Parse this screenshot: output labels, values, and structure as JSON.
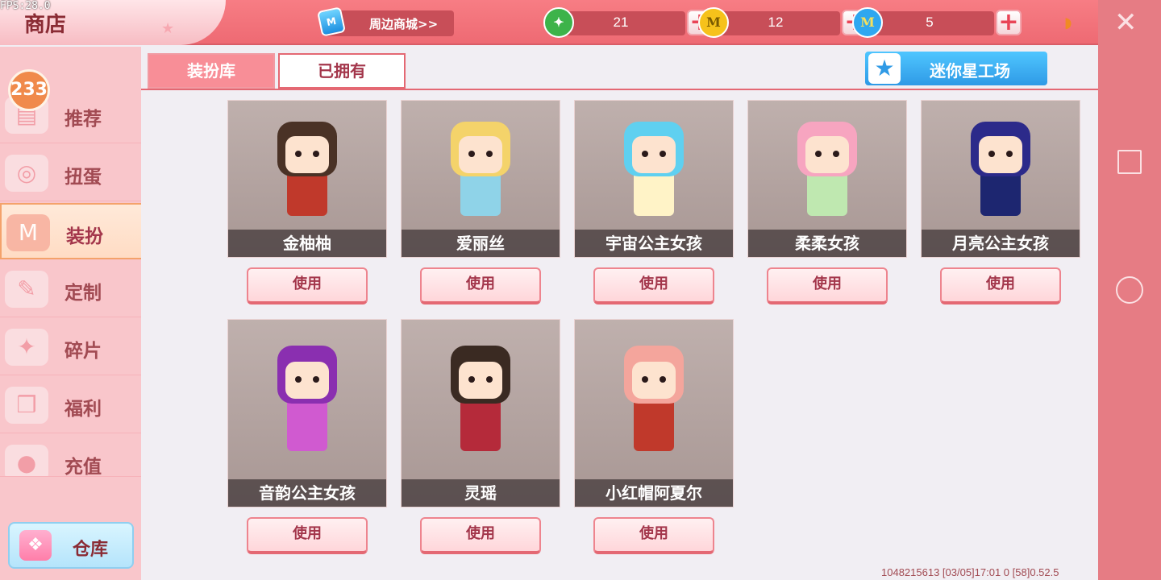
{
  "fps": "FPS:28.0",
  "header": {
    "title": "商店",
    "merch_label": "周边商城>>",
    "currencies": [
      {
        "name": "green-gem",
        "symbol": "✦",
        "amount": "21",
        "color": "#3db34a"
      },
      {
        "name": "gold-coin",
        "symbol": "M",
        "amount": "12",
        "color": "#f6c21b"
      },
      {
        "name": "blue-coin",
        "symbol": "M",
        "amount": "5",
        "color": "#2fa7f0"
      }
    ]
  },
  "sidebar": {
    "badge": "233",
    "items": [
      {
        "label": "推荐",
        "icon": "recommend-icon"
      },
      {
        "label": "扭蛋",
        "icon": "gacha-icon"
      },
      {
        "label": "装扮",
        "icon": "outfit-icon",
        "active": true
      },
      {
        "label": "定制",
        "icon": "custom-icon"
      },
      {
        "label": "碎片",
        "icon": "fragment-icon"
      },
      {
        "label": "福利",
        "icon": "gift-icon"
      },
      {
        "label": "充值",
        "icon": "recharge-icon"
      }
    ],
    "warehouse_label": "仓库"
  },
  "tabs": [
    {
      "label": "装扮库",
      "active": false
    },
    {
      "label": "已拥有",
      "active": true
    }
  ],
  "workshop_label": "迷你星工场",
  "use_label": "使用",
  "skins": [
    {
      "name": "金柚柚",
      "hair": "#4a3226",
      "outfit": "#c0392b"
    },
    {
      "name": "爱丽丝",
      "hair": "#f4d36a",
      "outfit": "#8fd3e8"
    },
    {
      "name": "宇宙公主女孩",
      "hair": "#5fd0f0",
      "outfit": "#fff3c7"
    },
    {
      "name": "柔柔女孩",
      "hair": "#f7a5c0",
      "outfit": "#bfe8b0"
    },
    {
      "name": "月亮公主女孩",
      "hair": "#2c2a8a",
      "outfit": "#1d2670"
    },
    {
      "name": "音韵公主女孩",
      "hair": "#8a2fb0",
      "outfit": "#d05ad0"
    },
    {
      "name": "灵瑶",
      "hair": "#3a2a22",
      "outfit": "#b52a3a"
    },
    {
      "name": "小红帽阿夏尔",
      "hair": "#f4a59c",
      "outfit": "#c0392b"
    }
  ],
  "footer": "1048215613   [03/05]17:01 0   [58]0.52.5"
}
